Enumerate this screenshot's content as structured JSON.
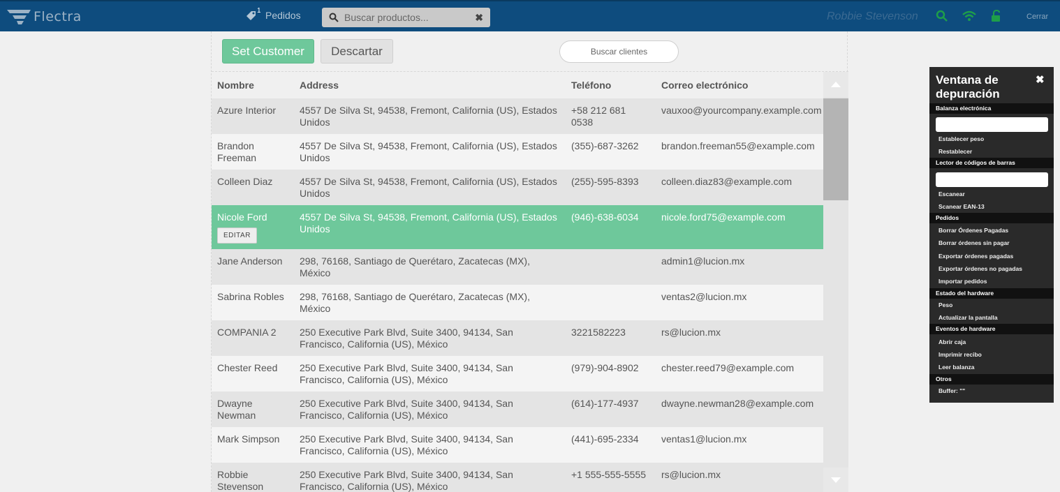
{
  "header": {
    "logo_text": "Flectra",
    "orders_badge": "1",
    "orders_label": "Pedidos",
    "search_placeholder": "Buscar productos...",
    "user_name": "Robbie Stevenson",
    "close_label": "Cerrar"
  },
  "client_screen": {
    "set_customer_label": "Set Customer",
    "discard_label": "Descartar",
    "search_placeholder": "Buscar clientes",
    "columns": [
      "Nombre",
      "Address",
      "Teléfono",
      "Correo electrónico"
    ],
    "edit_label": "EDITAR",
    "rows": [
      {
        "name": "Azure Interior",
        "address": "4557 De Silva St, 94538, Fremont, California (US), Estados Unidos",
        "phone": "+58 212 681 0538",
        "email": "vauxoo@yourcompany.example.com"
      },
      {
        "name": "Brandon Freeman",
        "address": "4557 De Silva St, 94538, Fremont, California (US), Estados Unidos",
        "phone": "(355)-687-3262",
        "email": "brandon.freeman55@example.com"
      },
      {
        "name": "Colleen Diaz",
        "address": "4557 De Silva St, 94538, Fremont, California (US), Estados Unidos",
        "phone": "(255)-595-8393",
        "email": "colleen.diaz83@example.com"
      },
      {
        "name": "Nicole Ford",
        "address": "4557 De Silva St, 94538, Fremont, California (US), Estados Unidos",
        "phone": "(946)-638-6034",
        "email": "nicole.ford75@example.com",
        "selected": true
      },
      {
        "name": "Jane Anderson",
        "address": "298, 76168, Santiago de Querétaro, Zacatecas (MX), México",
        "phone": "",
        "email": "admin1@lucion.mx"
      },
      {
        "name": "Sabrina Robles",
        "address": "298, 76168, Santiago de Querétaro, Zacatecas (MX), México",
        "phone": "",
        "email": "ventas2@lucion.mx"
      },
      {
        "name": "COMPANIA 2",
        "address": "250 Executive Park Blvd, Suite 3400, 94134, San Francisco, California (US), México",
        "phone": "3221582223",
        "email": "rs@lucion.mx"
      },
      {
        "name": "Chester Reed",
        "address": "250 Executive Park Blvd, Suite 3400, 94134, San Francisco, California (US), México",
        "phone": "(979)-904-8902",
        "email": "chester.reed79@example.com"
      },
      {
        "name": "Dwayne Newman",
        "address": "250 Executive Park Blvd, Suite 3400, 94134, San Francisco, California (US), México",
        "phone": "(614)-177-4937",
        "email": "dwayne.newman28@example.com"
      },
      {
        "name": "Mark Simpson",
        "address": "250 Executive Park Blvd, Suite 3400, 94134, San Francisco, California (US), México",
        "phone": "(441)-695-2334",
        "email": "ventas1@lucion.mx"
      },
      {
        "name": "Robbie Stevenson",
        "address": "250 Executive Park Blvd, Suite 3400, 94134, San Francisco, California (US), México",
        "phone": "+1 555-555-5555",
        "email": "rs@lucion.mx"
      }
    ]
  },
  "debug_window": {
    "title": "Ventana de depuración",
    "sections": {
      "scale": "Balanza electrónica",
      "scale_set": "Establecer peso",
      "scale_reset": "Restablecer",
      "barcode": "Lector de códigos de barras",
      "barcode_scan": "Escanear",
      "barcode_ean": "Scanear EAN-13",
      "orders": "Pedidos",
      "orders_del_paid": "Borrar Órdenes Pagadas",
      "orders_del_unpaid": "Borrar órdenes sin pagar",
      "orders_exp_paid": "Exportar órdenes pagadas",
      "orders_exp_unpaid": "Exportar órdenes no pagadas",
      "orders_import": "Importar pedidos",
      "hw_status": "Estado del hardware",
      "hw_weight": "Peso",
      "hw_refresh": "Actualizar la pantalla",
      "hw_events": "Eventos de hardware",
      "ev_open": "Abrir caja",
      "ev_print": "Imprimir recibo",
      "ev_read": "Leer balanza",
      "other": "Otros",
      "buffer": "Buffer: \"\""
    }
  },
  "colors": {
    "topbar": "#0e4c7e",
    "accent_green": "#6ec89b",
    "debug_bg": "#2a2a2a"
  }
}
